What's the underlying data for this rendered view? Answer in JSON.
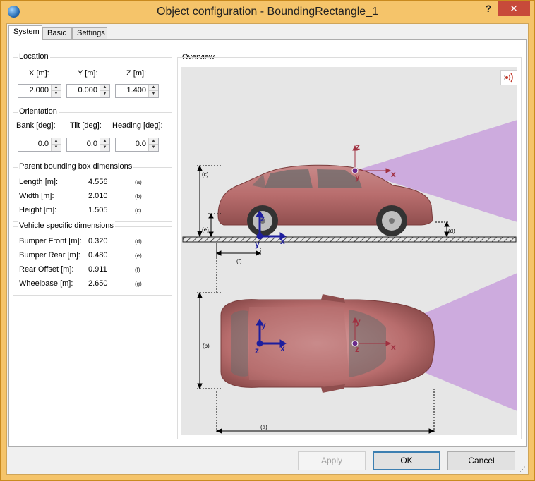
{
  "window": {
    "title": "Object configuration - BoundingRectangle_1",
    "help_label": "?",
    "close_label": "✕",
    "icon": "globe-icon"
  },
  "tabs": [
    {
      "label": "System",
      "active": true
    },
    {
      "label": "Basic",
      "active": false
    },
    {
      "label": "Settings",
      "active": false
    }
  ],
  "location": {
    "title": "Location",
    "x_label": "X [m]:",
    "y_label": "Y [m]:",
    "z_label": "Z [m]:",
    "x": "2.000",
    "y": "0.000",
    "z": "1.400"
  },
  "orientation": {
    "title": "Orientation",
    "bank_label": "Bank [deg]:",
    "tilt_label": "Tilt [deg]:",
    "heading_label": "Heading [deg]:",
    "bank": "0.0",
    "tilt": "0.0",
    "heading": "0.0"
  },
  "parent_bbox": {
    "title": "Parent bounding box dimensions",
    "rows": [
      {
        "label": "Length [m]:",
        "value": "4.556",
        "ref": "(a)"
      },
      {
        "label": "Width [m]:",
        "value": "2.010",
        "ref": "(b)"
      },
      {
        "label": "Height [m]:",
        "value": "1.505",
        "ref": "(c)"
      }
    ]
  },
  "vehicle_dims": {
    "title": "Vehicle specific dimensions",
    "rows": [
      {
        "label": "Bumper Front [m]:",
        "value": "0.320",
        "ref": "(d)"
      },
      {
        "label": "Bumper Rear [m]:",
        "value": "0.480",
        "ref": "(e)"
      },
      {
        "label": "Rear Offset [m]:",
        "value": "0.911",
        "ref": "(f)"
      },
      {
        "label": "Wheelbase [m]:",
        "value": "2.650",
        "ref": "(g)"
      }
    ]
  },
  "overview": {
    "title": "Overview",
    "sensor_icon": "sensor-wave-icon",
    "labels": {
      "a": "(a)",
      "b": "(b)",
      "c": "(c)",
      "d": "(d)",
      "e": "(e)",
      "f": "(f)",
      "x": "x",
      "y": "y",
      "z": "z"
    },
    "colors": {
      "background": "#e6e6e6",
      "car_body": "#b86d6d",
      "sensor_cone": "#c8a0dc",
      "axis_vehicle": "#1e1e9e",
      "axis_sensor": "#a03040"
    }
  },
  "buttons": {
    "apply": "Apply",
    "ok": "OK",
    "cancel": "Cancel"
  }
}
